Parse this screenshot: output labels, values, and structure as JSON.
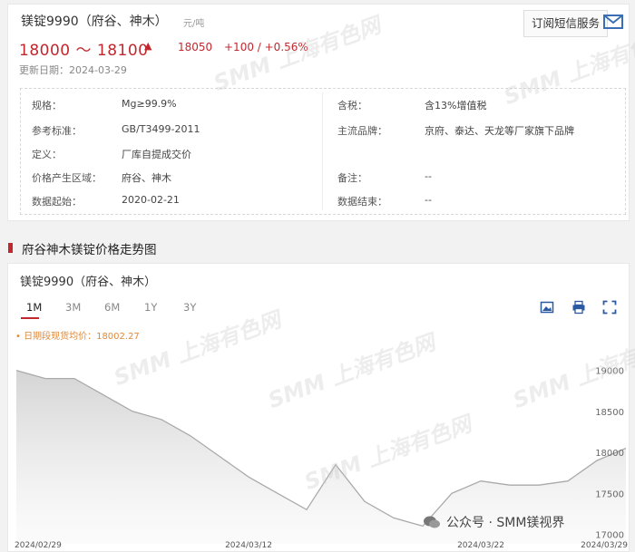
{
  "header": {
    "title": "镁锭9990（府谷、神木）",
    "unit": "元/吨",
    "subscribe_label": "订阅短信服务",
    "price_range": "18000 ～ 18100",
    "price_avg": "18050",
    "price_change": "+100 / +0.56%",
    "updated": "更新日期：2024-03-29"
  },
  "spec": {
    "left": [
      {
        "k": "规格：",
        "v": "Mg≥99.9%"
      },
      {
        "k": "参考标准：",
        "v": "GB/T3499-2011"
      },
      {
        "k": "定义：",
        "v": "厂库自提成交价"
      },
      {
        "k": "价格产生区域：",
        "v": "府谷、神木"
      },
      {
        "k": "数据起始：",
        "v": "2020-02-21"
      }
    ],
    "right": [
      {
        "k": "含税：",
        "v": "含13%增值税"
      },
      {
        "k": "主流品牌：",
        "v": "京府、泰达、天龙等厂家旗下品牌"
      },
      {
        "k": "备注：",
        "v": "--"
      },
      {
        "k": "数据结束：",
        "v": "--"
      }
    ]
  },
  "section_title": "府谷神木镁锭价格走势图",
  "chart_panel": {
    "name": "镁锭9990（府谷、神木）",
    "tabs": [
      "1M",
      "3M",
      "6M",
      "1Y",
      "3Y"
    ],
    "active_tab": "1M",
    "legend": "• 日期段现货均价：18002.27"
  },
  "watermark_text": "SMM 上海有色网",
  "wechat_text": "公众号 · SMM镁视界",
  "colors": {
    "accent": "#c0282e",
    "line": "#aaaaaa",
    "legend": "#e08a3c"
  },
  "chart_data": {
    "type": "area",
    "x": [
      "2024/02/29",
      "2024/03/01",
      "2024/03/04",
      "2024/03/05",
      "2024/03/06",
      "2024/03/07",
      "2024/03/08",
      "2024/03/11",
      "2024/03/12",
      "2024/03/13",
      "2024/03/14",
      "2024/03/15",
      "2024/03/18",
      "2024/03/19",
      "2024/03/20",
      "2024/03/21",
      "2024/03/22",
      "2024/03/25",
      "2024/03/26",
      "2024/03/27",
      "2024/03/28",
      "2024/03/29"
    ],
    "values": [
      19000,
      18900,
      18900,
      18700,
      18500,
      18400,
      18200,
      17950,
      17700,
      17500,
      17300,
      17850,
      17400,
      17200,
      17100,
      17500,
      17650,
      17600,
      17600,
      17650,
      17900,
      18050
    ],
    "xticks": [
      "2024/02/29",
      "2024/03/12",
      "2024/03/22",
      "2024/03/29"
    ],
    "yticks": [
      17000,
      17500,
      18000,
      18500,
      19000
    ],
    "ylim": [
      16950,
      19150
    ]
  }
}
